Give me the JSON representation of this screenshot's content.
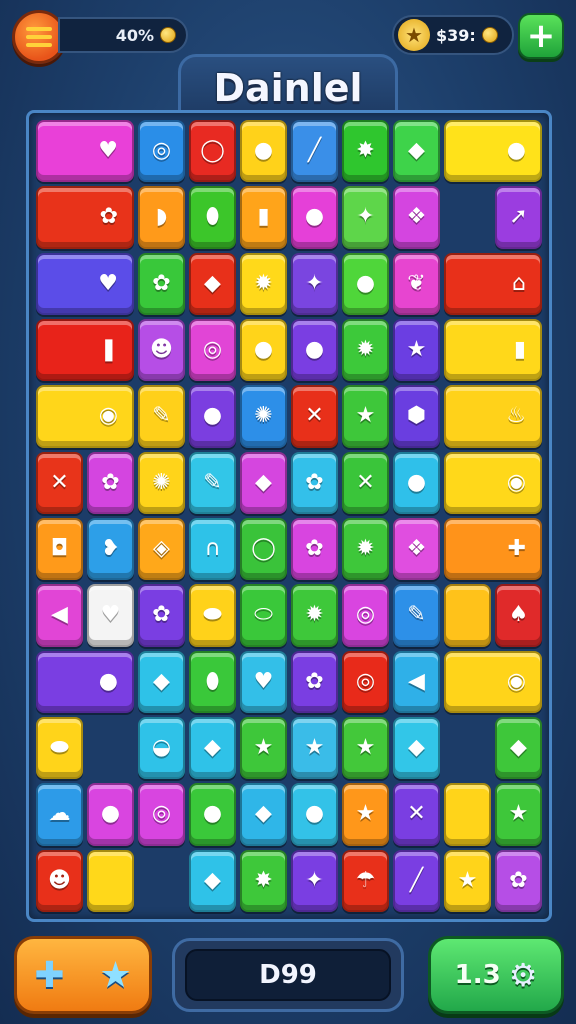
{
  "header": {
    "progress_text": "40%",
    "currency_text": "$39:",
    "plus_label": "+",
    "star_symbol": "★",
    "coin_icon": "coin-icon",
    "menu_icon": "menu-icon"
  },
  "title": "Dainlel",
  "board": {
    "rows": [
      [
        {
          "c": "#e940d8",
          "g": "♥",
          "w": 2
        },
        {
          "c": "#2a8ee8",
          "g": "◎"
        },
        {
          "c": "#e82a22",
          "g": "◯"
        },
        {
          "c": "#ffd21a",
          "g": "●"
        },
        {
          "c": "#3a8fe8",
          "g": "╱"
        },
        {
          "c": "#2fc62e",
          "g": "✸"
        },
        {
          "c": "#3ed34a",
          "g": "◆"
        },
        {
          "c": "#ffe21a",
          "g": "●",
          "w": 2
        }
      ],
      [
        {
          "c": "#e8331a",
          "g": "✿",
          "w": 2
        },
        {
          "c": "#ff9a1a",
          "g": "◗"
        },
        {
          "c": "#3cc62a",
          "g": "⬮"
        },
        {
          "c": "#ffa41a",
          "g": "▮"
        },
        {
          "c": "#e540d8",
          "g": "●"
        },
        {
          "c": "#5ed64a",
          "g": "✦"
        },
        {
          "c": "#d445e0",
          "g": "❖"
        },
        {
          "c": "",
          "g": ""
        },
        {
          "c": "#9b3de0",
          "g": "➚"
        }
      ],
      [
        {
          "c": "#5b4de8",
          "g": "♥",
          "w": 2
        },
        {
          "c": "#39c83a",
          "g": "✿"
        },
        {
          "c": "#e8301a",
          "g": "◆"
        },
        {
          "c": "#ffd91a",
          "g": "✹"
        },
        {
          "c": "#7a45e0",
          "g": "✦"
        },
        {
          "c": "#4fd63a",
          "g": "●"
        },
        {
          "c": "#e745d0",
          "g": "❦"
        },
        {
          "c": "#e8301a",
          "g": "⌂",
          "w": 2
        }
      ],
      [
        {
          "c": "#e8231a",
          "g": "❚",
          "w": 2
        },
        {
          "c": "#b64ee6",
          "g": "☻"
        },
        {
          "c": "#e145d6",
          "g": "◎"
        },
        {
          "c": "#ffd41a",
          "g": "●"
        },
        {
          "c": "#7a3ee2",
          "g": "●"
        },
        {
          "c": "#3dc93a",
          "g": "✹"
        },
        {
          "c": "#6b3ee2",
          "g": "★"
        },
        {
          "c": "#ffd81a",
          "g": "▮",
          "w": 2
        }
      ],
      [
        {
          "c": "#ffd61a",
          "g": "◉",
          "w": 2
        },
        {
          "c": "#ffd01a",
          "g": "✎"
        },
        {
          "c": "#7b3ee0",
          "g": "●"
        },
        {
          "c": "#2d8fe8",
          "g": "✺"
        },
        {
          "c": "#e8301a",
          "g": "✕"
        },
        {
          "c": "#3ec73a",
          "g": "★"
        },
        {
          "c": "#6a3ee0",
          "g": "⬢"
        },
        {
          "c": "#ffd21a",
          "g": "♨",
          "w": 2
        }
      ],
      [
        {
          "c": "#e8341a",
          "g": "✕"
        },
        {
          "c": "#d445e0",
          "g": "✿"
        },
        {
          "c": "#ffd41a",
          "g": "✺"
        },
        {
          "c": "#32c6e8",
          "g": "✎"
        },
        {
          "c": "#d546df",
          "g": "◆"
        },
        {
          "c": "#33c0ea",
          "g": "✿"
        },
        {
          "c": "#3ac53a",
          "g": "✕"
        },
        {
          "c": "#2fc0ea",
          "g": "●"
        },
        {
          "c": "#ffd81a",
          "g": "◉",
          "w": 2
        }
      ],
      [
        {
          "c": "#ff9a1a",
          "g": "◘"
        },
        {
          "c": "#2d9fe8",
          "g": "❥"
        },
        {
          "c": "#ffa81a",
          "g": "◈"
        },
        {
          "c": "#2ec2e8",
          "g": "∩"
        },
        {
          "c": "#3ac33a",
          "g": "◯"
        },
        {
          "c": "#d845e0",
          "g": "✿"
        },
        {
          "c": "#3ec73a",
          "g": "✹"
        },
        {
          "c": "#e04ee0",
          "g": "❖"
        },
        {
          "c": "#ff931a",
          "g": "✚",
          "w": 2
        }
      ],
      [
        {
          "c": "#e145d6",
          "g": "◀"
        },
        {
          "c": "#f4f4f4",
          "g": "♥"
        },
        {
          "c": "#7a3ee2",
          "g": "✿"
        },
        {
          "c": "#ffd21a",
          "g": "⬬"
        },
        {
          "c": "#3ac83a",
          "g": "⬭"
        },
        {
          "c": "#3ec83a",
          "g": "✹"
        },
        {
          "c": "#d945e0",
          "g": "◎"
        },
        {
          "c": "#2d90e8",
          "g": "✎"
        },
        {
          "c": "#ffc21a",
          "g": ""
        },
        {
          "c": "#e02a2a",
          "g": "♠"
        }
      ],
      [
        {
          "c": "#7a3ee2",
          "g": "●",
          "w": 2
        },
        {
          "c": "#2ec2e8",
          "g": "◆"
        },
        {
          "c": "#3ac83a",
          "g": "⬮"
        },
        {
          "c": "#33bfe8",
          "g": "♥"
        },
        {
          "c": "#7a3ee2",
          "g": "✿"
        },
        {
          "c": "#e82a1a",
          "g": "◎"
        },
        {
          "c": "#2fb0e8",
          "g": "◀"
        },
        {
          "c": "#ffd41a",
          "g": "◉",
          "w": 2
        }
      ],
      [
        {
          "c": "#ffd41a",
          "g": "⬬"
        },
        {
          "c": "",
          "g": ""
        },
        {
          "c": "#2fc2e8",
          "g": "◒"
        },
        {
          "c": "#2fc2e8",
          "g": "◆"
        },
        {
          "c": "#3ec73a",
          "g": "★"
        },
        {
          "c": "#3abce8",
          "g": "★"
        },
        {
          "c": "#43c83a",
          "g": "★"
        },
        {
          "c": "#32c6e8",
          "g": "◆"
        },
        {
          "c": "",
          "g": ""
        },
        {
          "c": "#3ec73a",
          "g": "◆"
        }
      ],
      [
        {
          "c": "#2d9be8",
          "g": "☁"
        },
        {
          "c": "#d945e0",
          "g": "●"
        },
        {
          "c": "#d845e0",
          "g": "◎"
        },
        {
          "c": "#3ac83a",
          "g": "●"
        },
        {
          "c": "#2fb6e8",
          "g": "◆"
        },
        {
          "c": "#33c2e8",
          "g": "●"
        },
        {
          "c": "#ff971a",
          "g": "★"
        },
        {
          "c": "#7a3ee2",
          "g": "✕"
        },
        {
          "c": "#ffd41a",
          "g": ""
        },
        {
          "c": "#3ec73a",
          "g": "★"
        }
      ],
      [
        {
          "c": "#e8301a",
          "g": "☻"
        },
        {
          "c": "#ffd81a",
          "g": ""
        },
        {
          "c": "",
          "g": ""
        },
        {
          "c": "#2fc2e8",
          "g": "◆"
        },
        {
          "c": "#3ec83a",
          "g": "✸"
        },
        {
          "c": "#7a3ee2",
          "g": "✦"
        },
        {
          "c": "#e8301a",
          "g": "☂"
        },
        {
          "c": "#7a3ee2",
          "g": "╱"
        },
        {
          "c": "#ffd41a",
          "g": "★"
        },
        {
          "c": "#b64ee6",
          "g": "✿"
        }
      ]
    ]
  },
  "footer": {
    "left_icons": [
      "cross-icon",
      "star-icon"
    ],
    "center_text": "D99",
    "right_text": "1.3",
    "right_icon": "gear-icon"
  }
}
